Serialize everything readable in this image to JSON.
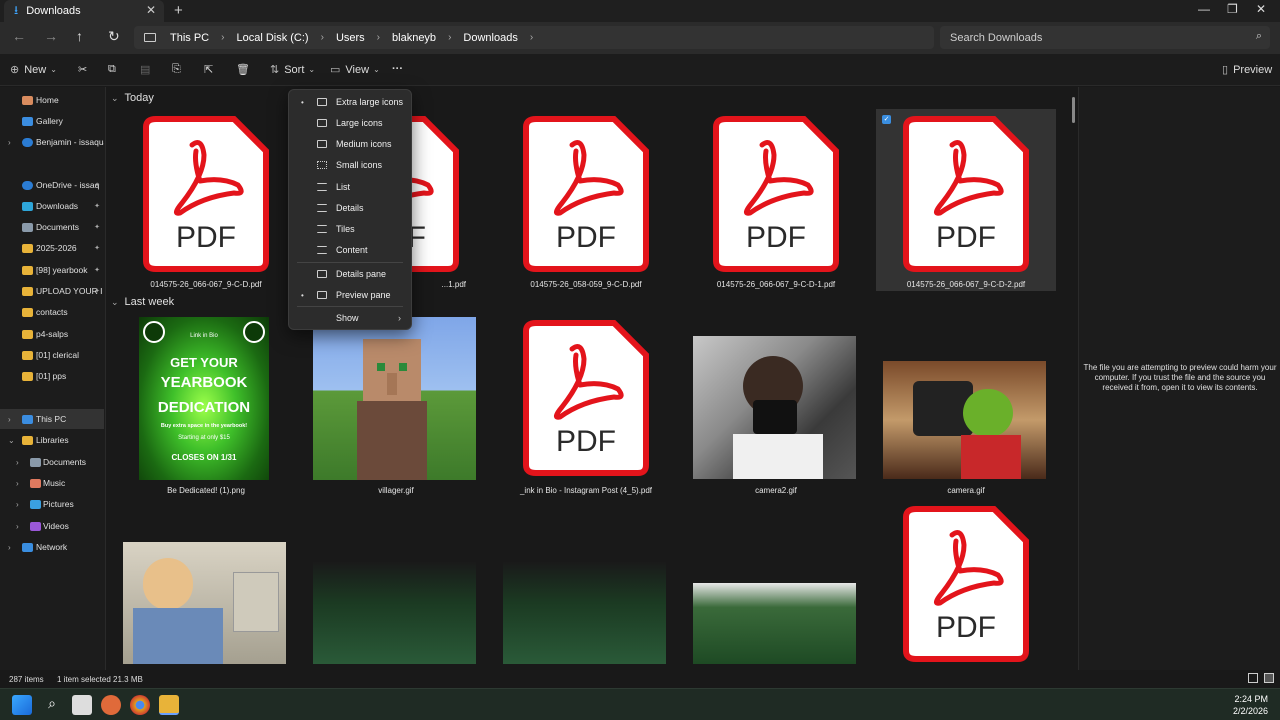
{
  "window": {
    "tab_title": "Downloads",
    "tab_close": "✕",
    "new_tab": "+",
    "minimize": "—",
    "maximize": "❐",
    "close": "✕"
  },
  "nav_buttons": {
    "back": "←",
    "forward": "→",
    "up": "↑",
    "refresh": "↻"
  },
  "breadcrumbs": [
    "This PC",
    "Local Disk (C:)",
    "Users",
    "blakneyb",
    "Downloads"
  ],
  "breadcrumb_sep": "›",
  "search": {
    "placeholder": "Search Downloads",
    "icon": "search-icon"
  },
  "toolbar": {
    "new_label": "New",
    "sort_label": "Sort",
    "view_label": "View",
    "more_label": "···",
    "preview_label": "Preview",
    "icons": [
      "cut-icon",
      "copy-icon",
      "paste-icon",
      "rename-icon",
      "share-icon",
      "delete-icon"
    ]
  },
  "sidebar": {
    "items": [
      {
        "label": "Home",
        "icon": "home-icon"
      },
      {
        "label": "Gallery",
        "icon": "gallery-icon"
      },
      {
        "label": "Benjamin - issaqua",
        "icon": "cloud-icon"
      },
      {
        "label": "OneDrive - issaq",
        "icon": "cloud-icon"
      },
      {
        "label": "Downloads",
        "icon": "download-icon"
      },
      {
        "label": "Documents",
        "icon": "documents-icon"
      },
      {
        "label": "2025-2026",
        "icon": "folder-icon"
      },
      {
        "label": "[98] yearbook",
        "icon": "folder-icon"
      },
      {
        "label": "UPLOAD YOUR I",
        "icon": "folder-icon"
      },
      {
        "label": "contacts",
        "icon": "folder-icon"
      },
      {
        "label": "p4-salps",
        "icon": "folder-icon"
      },
      {
        "label": "[01] clerical",
        "icon": "folder-icon"
      },
      {
        "label": "[01] pps",
        "icon": "folder-icon"
      },
      {
        "label": "This PC",
        "icon": "pc-icon"
      },
      {
        "label": "Libraries",
        "icon": "folder-icon"
      },
      {
        "label": "Documents",
        "icon": "documents-icon"
      },
      {
        "label": "Music",
        "icon": "music-icon"
      },
      {
        "label": "Pictures",
        "icon": "pictures-icon"
      },
      {
        "label": "Videos",
        "icon": "videos-icon"
      },
      {
        "label": "Network",
        "icon": "network-icon"
      }
    ]
  },
  "groups": {
    "today": "Today",
    "last_week": "Last week"
  },
  "files_today": [
    {
      "name": "014575-26_066-067_9-C-D.pdf"
    },
    {
      "name": "...1.pdf"
    },
    {
      "name": "014575-26_058-059_9-C-D.pdf"
    },
    {
      "name": "014575-26_066-067_9-C-D-1.pdf"
    },
    {
      "name": "014575-26_066-067_9-C-D-2.pdf"
    }
  ],
  "files_last_week": [
    {
      "name": "Be Dedicated! (1).png"
    },
    {
      "name": "villager.gif"
    },
    {
      "name": "_ink in Bio - Instagram Post (4_5).pdf"
    },
    {
      "name": "camera2.gif"
    },
    {
      "name": "camera.gif"
    }
  ],
  "pdf_label": "PDF",
  "yearbook_promo": {
    "link": "Link in Bio",
    "line1": "GET YOUR",
    "line2": "YEARBOOK",
    "line3": "DEDICATION",
    "line4": "Buy extra space in the yearbook!",
    "line5": "Starting at only $15",
    "line6": "CLOSES ON 1/31"
  },
  "view_menu": {
    "items": [
      {
        "label": "Extra large icons",
        "bullet": "•"
      },
      {
        "label": "Large icons",
        "bullet": ""
      },
      {
        "label": "Medium icons",
        "bullet": ""
      },
      {
        "label": "Small icons",
        "bullet": ""
      },
      {
        "label": "List",
        "bullet": ""
      },
      {
        "label": "Details",
        "bullet": ""
      },
      {
        "label": "Tiles",
        "bullet": ""
      },
      {
        "label": "Content",
        "bullet": ""
      },
      {
        "label": "Details pane",
        "bullet": ""
      },
      {
        "label": "Preview pane",
        "bullet": "•"
      },
      {
        "label": "Show",
        "bullet": "",
        "arrow": "›"
      }
    ]
  },
  "preview_pane": {
    "message": "The file you are attempting to preview could harm your computer. If you trust the file and the source you received it from, open it to view its contents."
  },
  "status": {
    "items_count": "287 items",
    "selection": "1 item selected  21.3 MB"
  },
  "clock": {
    "time": "2:24 PM",
    "date": "2/2/2026"
  },
  "colors": {
    "pdf_red": "#e3141b",
    "accent": "#3a8ee0",
    "folder": "#e8b339"
  }
}
